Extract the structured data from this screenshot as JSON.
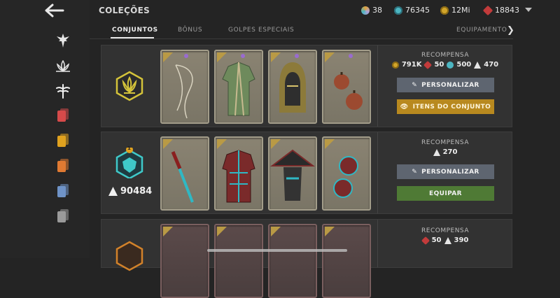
{
  "header": {
    "title": "COLEÇÕES",
    "resources": [
      {
        "icon": "orb-icon",
        "value": "38",
        "color": "#b1a2d9"
      },
      {
        "icon": "spirit-icon",
        "value": "76345",
        "color": "#4cb6c2"
      },
      {
        "icon": "coin-icon",
        "value": "12Mi",
        "color": "#d2a52a"
      },
      {
        "icon": "ruby-icon",
        "value": "18843",
        "color": "#c23b3b"
      }
    ]
  },
  "tabs": [
    {
      "label": "CONJUNTOS",
      "active": true
    },
    {
      "label": "BÔNUS",
      "active": false
    },
    {
      "label": "GOLPES ESPECIAIS",
      "active": false
    },
    {
      "label": "EQUIPAMENTO",
      "active": false
    }
  ],
  "sidebar": {
    "items": [
      {
        "icon": "dynasty-emblem-icon"
      },
      {
        "icon": "lotus-emblem-icon"
      },
      {
        "icon": "dragonfly-emblem-icon"
      },
      {
        "icon": "red-card-stack-icon",
        "color": "#d64a4a"
      },
      {
        "icon": "gold-card-stack-icon",
        "color": "#e0a21f"
      },
      {
        "icon": "orange-card-stack-icon",
        "color": "#e07a32"
      },
      {
        "icon": "blue-card-stack-icon",
        "color": "#6f93c7"
      },
      {
        "icon": "grey-card-stack-icon",
        "color": "#9a9a9a"
      }
    ]
  },
  "sets": [
    {
      "emblem_color": "#d4c33a",
      "items": [
        "whip-weapon",
        "green-robe-armor",
        "hooded-mask-helm",
        "gourd-bombs"
      ],
      "reward_label": "RECOMPENSA",
      "rewards": [
        {
          "icon": "coin-icon",
          "value": "791K",
          "color": "#d2a52a"
        },
        {
          "icon": "ruby-icon",
          "value": "50",
          "color": "#c23b3b"
        },
        {
          "icon": "spirit-icon",
          "value": "500",
          "color": "#4cb6c2"
        },
        {
          "icon": "shard-icon",
          "value": "470",
          "color": "#e6e6e6"
        }
      ],
      "buttons": [
        {
          "label": "PERSONALIZAR",
          "style": "grey",
          "icon": "brush-icon"
        },
        {
          "label": "ITENS DO CONJUNTO",
          "style": "gold",
          "icon": "eye-icon"
        }
      ]
    },
    {
      "emblem_color": "#3fc9c9",
      "emblem_badge": "1",
      "shard_total": "90484",
      "items": [
        "katana-weapon",
        "red-plated-armor",
        "straw-hat-helm",
        "spiked-shields"
      ],
      "reward_label": "RECOMPENSA",
      "rewards": [
        {
          "icon": "shard-icon",
          "value": "270",
          "color": "#e6e6e6"
        }
      ],
      "buttons": [
        {
          "label": "PERSONALIZAR",
          "style": "grey",
          "icon": "brush-icon"
        },
        {
          "label": "EQUIPAR",
          "style": "green",
          "icon": ""
        }
      ]
    },
    {
      "emblem_color": "#d2822a",
      "items": [
        "red-weapon",
        "red-armor",
        "red-helm",
        "red-ranged"
      ],
      "reward_label": "RECOMPENSA",
      "rewards": [
        {
          "icon": "ruby-icon",
          "value": "50",
          "color": "#c23b3b"
        },
        {
          "icon": "shard-icon",
          "value": "390",
          "color": "#e6e6e6"
        }
      ]
    }
  ]
}
